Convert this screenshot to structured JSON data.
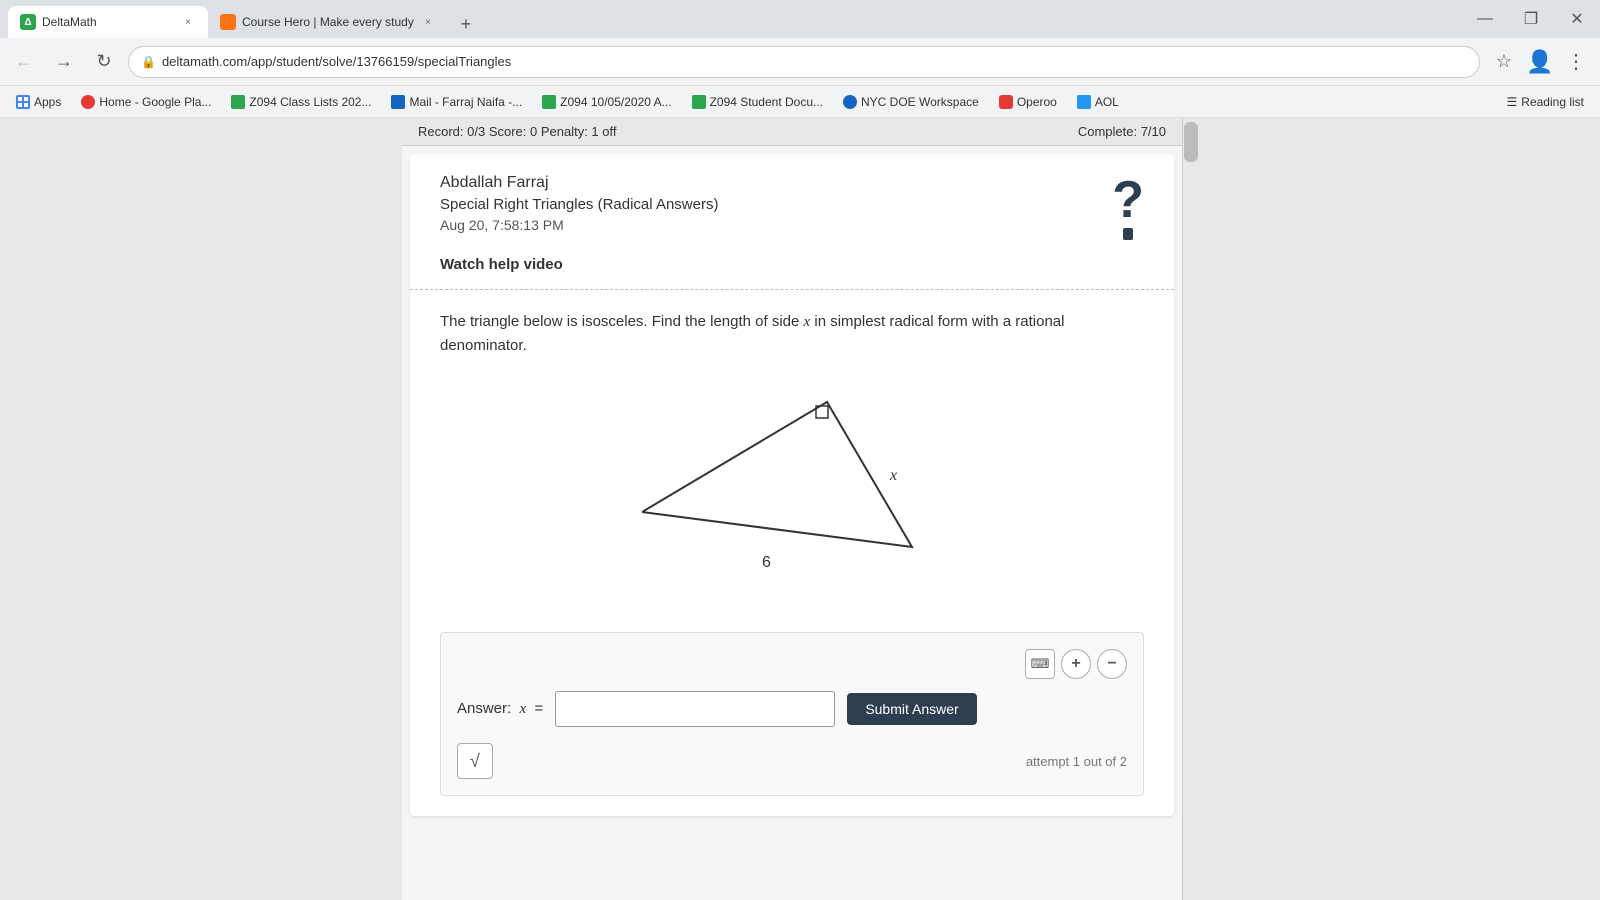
{
  "browser": {
    "tabs": [
      {
        "id": "deltaMath",
        "label": "DeltaMath",
        "icon_color": "#2da44e",
        "active": true,
        "close_label": "×"
      },
      {
        "id": "courseHero",
        "label": "Course Hero | Make every study",
        "icon_color": "#f97316",
        "active": false,
        "close_label": "×"
      }
    ],
    "new_tab_label": "+",
    "window_controls": {
      "minimize": "—",
      "maximize": "❐",
      "close": "✕"
    },
    "address": "deltamath.com/app/student/solve/13766159/specialTriangles",
    "lock_icon": "🔒"
  },
  "bookmarks": [
    {
      "label": "Apps",
      "icon": "grid",
      "icon_color": "#4285f4"
    },
    {
      "label": "Home - Google Pla...",
      "icon": "home",
      "icon_color": "#e53935"
    },
    {
      "label": "Z094 Class Lists 202...",
      "icon": "doc",
      "icon_color": "#2da44e"
    },
    {
      "label": "Mail - Farraj Naifa -...",
      "icon": "mail",
      "icon_color": "#1565c0"
    },
    {
      "label": "Z094 10/05/2020 A...",
      "icon": "doc",
      "icon_color": "#2da44e"
    },
    {
      "label": "Z094 Student Docu...",
      "icon": "doc",
      "icon_color": "#2da44e"
    },
    {
      "label": "NYC DOE Workspace",
      "icon": "globe",
      "icon_color": "#1565c0"
    },
    {
      "label": "Operoo",
      "icon": "op",
      "icon_color": "#e53935"
    },
    {
      "label": "AOL",
      "icon": "aol",
      "icon_color": "#2196f3"
    },
    {
      "label": "Reading list",
      "icon": "list",
      "icon_color": "#555"
    }
  ],
  "record_bar": {
    "left": "Record: 0/3   Score: 0   Penalty: 1 off",
    "right": "Complete: 7/10"
  },
  "student": {
    "name": "Abdallah Farraj",
    "assignment": "Special Right Triangles (Radical Answers)",
    "timestamp": "Aug 20, 7:58:13 PM"
  },
  "help": {
    "watch_video_label": "Watch help video"
  },
  "problem": {
    "text_before": "The triangle below is isosceles. Find the length of side ",
    "variable": "x",
    "text_after": " in simplest radical form with a rational denominator."
  },
  "triangle": {
    "label_bottom": "6",
    "label_side": "x"
  },
  "answer": {
    "label": "Answer:",
    "variable": "x",
    "equals": "=",
    "input_value": "",
    "input_placeholder": "",
    "submit_label": "Submit Answer",
    "check_symbol": "√",
    "attempt_text": "attempt 1 out of 2"
  },
  "toolbar": {
    "keyboard_icon": "⌨",
    "plus_icon": "+",
    "minus_icon": "−"
  }
}
